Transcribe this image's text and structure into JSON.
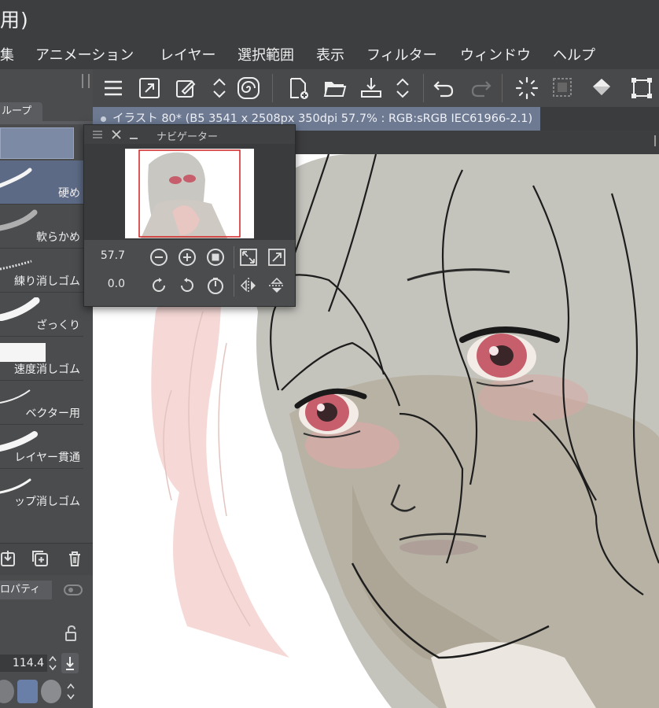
{
  "window": {
    "title_fragment": "用)"
  },
  "menu": [
    "集",
    "アニメーション",
    "レイヤー",
    "選択範囲",
    "表示",
    "フィルター",
    "ウィンドウ",
    "ヘルプ"
  ],
  "left_panel": {
    "group_tab": "ループ",
    "brushes": [
      {
        "label": "硬め",
        "selected": true
      },
      {
        "label": "軟らかめ",
        "selected": false
      },
      {
        "label": "練り消しゴム",
        "selected": false
      },
      {
        "label": "ざっくり",
        "selected": false
      },
      {
        "label": "速度消しゴム",
        "selected": false
      },
      {
        "label": "ベクター用",
        "selected": false
      },
      {
        "label": "レイヤー貫通",
        "selected": false
      },
      {
        "label": "ップ消しゴム",
        "selected": false
      }
    ],
    "property_tab": "ロパティ",
    "brush_size": "114.4"
  },
  "document_tab": {
    "label": "イラスト 80* (B5 3541 x 2508px 350dpi 57.7% : RGB:sRGB IEC61966-2.1)"
  },
  "navigator": {
    "title": "ナビゲーター",
    "zoom": "57.7",
    "rotation": "0.0"
  },
  "icons": {
    "toolbar": [
      "menu-icon",
      "fullscreen-icon",
      "edit-icon",
      "updown-icon",
      "spiral-icon",
      "new-canvas-icon",
      "open-folder-icon",
      "save-icon",
      "updown-icon",
      "undo-icon",
      "redo-icon",
      "loading-icon",
      "selection-icon",
      "fill-icon",
      "transform-icon"
    ]
  },
  "colors": {
    "accent": "#6d7a92",
    "selected_brush": "#5d6a86",
    "panel": "#4a4c4e",
    "toolbar": "#47494b"
  }
}
